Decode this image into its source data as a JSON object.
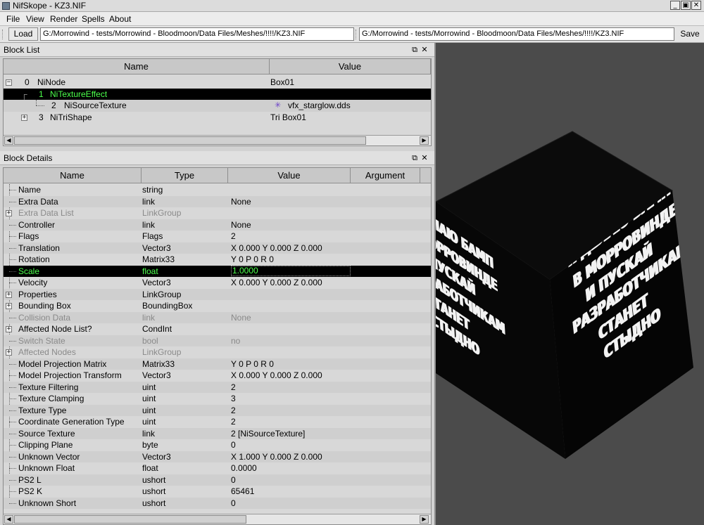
{
  "window": {
    "title": "NifSkope - KZ3.NIF",
    "controls": {
      "minimize": "_",
      "restore": "▣",
      "close": "✕"
    }
  },
  "menu": [
    "File",
    "View",
    "Render",
    "Spells",
    "About"
  ],
  "toolbar": {
    "load_label": "Load",
    "load_path": "G:/Morrowind - tests/Morrowind - Bloodmoon/Data Files/Meshes/!!!!/KZ3.NIF",
    "save_path": "G:/Morrowind - tests/Morrowind - Bloodmoon/Data Files/Meshes/!!!!/KZ3.NIF",
    "save_label": "Save"
  },
  "block_list": {
    "title": "Block List",
    "columns": [
      "Name",
      "Value"
    ],
    "rows": [
      {
        "id": "0",
        "name": "NiNode",
        "value": "Box01"
      },
      {
        "id": "1",
        "name": "NiTextureEffect",
        "value": ""
      },
      {
        "id": "2",
        "name": "NiSourceTexture",
        "value": "vfx_starglow.dds"
      },
      {
        "id": "3",
        "name": "NiTriShape",
        "value": "Tri Box01"
      }
    ]
  },
  "block_details": {
    "title": "Block Details",
    "columns": [
      "Name",
      "Type",
      "Value",
      "Argument"
    ],
    "rows": [
      {
        "name": "Name",
        "type": "string",
        "value": ""
      },
      {
        "name": "Extra Data",
        "type": "link",
        "value": "None"
      },
      {
        "name": "Extra Data List",
        "type": "LinkGroup",
        "value": ""
      },
      {
        "name": "Controller",
        "type": "link",
        "value": "None"
      },
      {
        "name": "Flags",
        "type": "Flags",
        "value": "2"
      },
      {
        "name": "Translation",
        "type": "Vector3",
        "value": "X 0.000 Y 0.000 Z 0.000"
      },
      {
        "name": "Rotation",
        "type": "Matrix33",
        "value": "Y 0 P 0 R 0"
      },
      {
        "name": "Scale",
        "type": "float",
        "value": "1.0000"
      },
      {
        "name": "Velocity",
        "type": "Vector3",
        "value": "X 0.000 Y 0.000 Z 0.000"
      },
      {
        "name": "Properties",
        "type": "LinkGroup",
        "value": ""
      },
      {
        "name": "Bounding Box",
        "type": "BoundingBox",
        "value": ""
      },
      {
        "name": "Collision Data",
        "type": "link",
        "value": "None"
      },
      {
        "name": "Affected Node List?",
        "type": "CondInt",
        "value": ""
      },
      {
        "name": "Switch State",
        "type": "bool",
        "value": "no"
      },
      {
        "name": "Affected Nodes",
        "type": "LinkGroup",
        "value": ""
      },
      {
        "name": "Model Projection Matrix",
        "type": "Matrix33",
        "value": "Y 0 P 0 R 0"
      },
      {
        "name": "Model Projection Transform",
        "type": "Vector3",
        "value": "X 0.000 Y 0.000 Z 0.000"
      },
      {
        "name": "Texture Filtering",
        "type": "uint",
        "value": "2"
      },
      {
        "name": "Texture Clamping",
        "type": "uint",
        "value": "3"
      },
      {
        "name": "Texture Type",
        "type": "uint",
        "value": "2"
      },
      {
        "name": "Coordinate Generation Type",
        "type": "uint",
        "value": "2"
      },
      {
        "name": "Source Texture",
        "type": "link",
        "value": "2 [NiSourceTexture]"
      },
      {
        "name": "Clipping Plane",
        "type": "byte",
        "value": "0"
      },
      {
        "name": "Unknown Vector",
        "type": "Vector3",
        "value": "X 1.000 Y 0.000 Z 0.000"
      },
      {
        "name": "Unknown Float",
        "type": "float",
        "value": "0.0000"
      },
      {
        "name": "PS2 L",
        "type": "ushort",
        "value": "0"
      },
      {
        "name": "PS2 K",
        "type": "ushort",
        "value": "65461"
      },
      {
        "name": "Unknown Short",
        "type": "ushort",
        "value": "0"
      }
    ]
  },
  "viewport": {
    "cube_texture_lines": [
      "Я ДЕЛАЮ БАМП",
      "В МОРРОВИНДЕ",
      "И ПУСКАЙ",
      "РАЗРАБОТЧИКАМ",
      "СТАНЕТ",
      "СТЫДНО"
    ]
  },
  "colors": {
    "selection_bg": "#000000",
    "selection_text": "#4cff4c",
    "viewport_bg": "#4b4b4b"
  }
}
